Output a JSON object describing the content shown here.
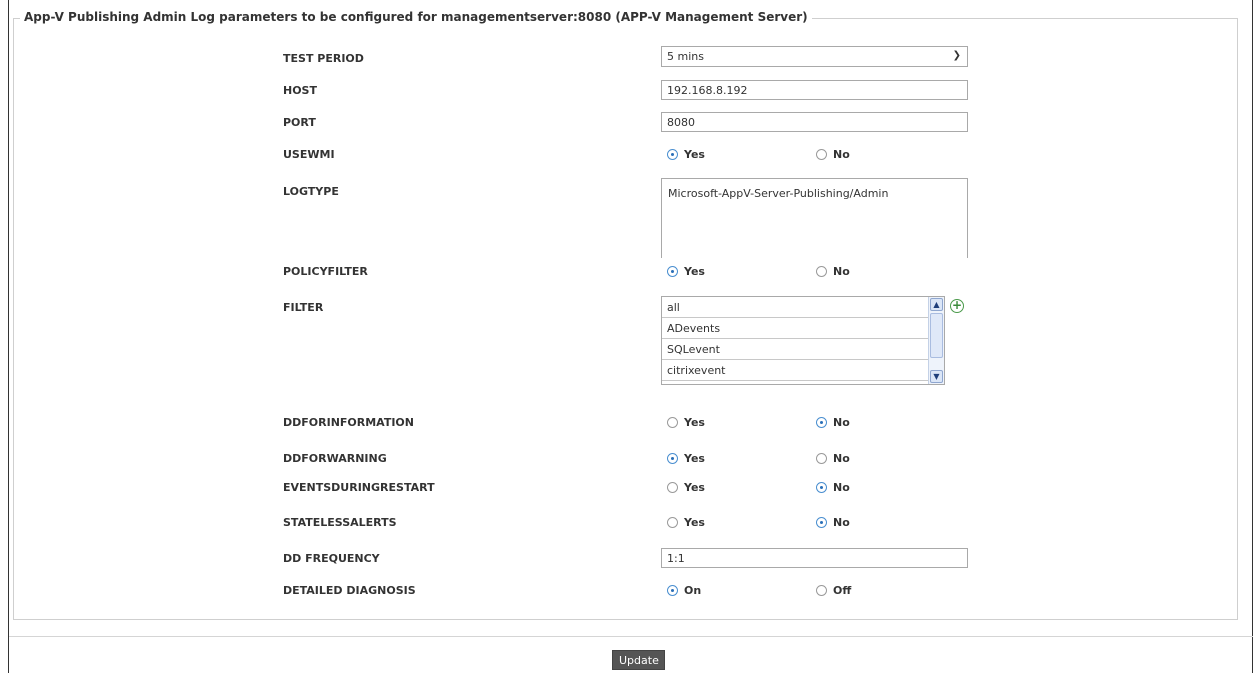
{
  "legend": "App-V Publishing Admin Log parameters to be configured for managementserver:8080 (APP-V Management Server)",
  "fields": {
    "test_period": {
      "label": "TEST PERIOD",
      "value": "5 mins"
    },
    "host": {
      "label": "HOST",
      "value": "192.168.8.192"
    },
    "port": {
      "label": "PORT",
      "value": "8080"
    },
    "usewmi": {
      "label": "USEWMI",
      "yes": "Yes",
      "no": "No",
      "selected": "Yes"
    },
    "logtype": {
      "label": "LOGTYPE",
      "value": "Microsoft-AppV-Server-Publishing/Admin"
    },
    "policyfilter": {
      "label": "POLICYFILTER",
      "yes": "Yes",
      "no": "No",
      "selected": "Yes"
    },
    "filter": {
      "label": "FILTER",
      "options": [
        "all",
        "ADevents",
        "SQLevent",
        "citrixevent"
      ]
    },
    "ddforinformation": {
      "label": "DDFORINFORMATION",
      "yes": "Yes",
      "no": "No",
      "selected": "No"
    },
    "ddforwarning": {
      "label": "DDFORWARNING",
      "yes": "Yes",
      "no": "No",
      "selected": "Yes"
    },
    "eventsduringrestart": {
      "label": "EVENTSDURINGRESTART",
      "yes": "Yes",
      "no": "No",
      "selected": "No"
    },
    "statelessalerts": {
      "label": "STATELESSALERTS",
      "yes": "Yes",
      "no": "No",
      "selected": "No"
    },
    "dd_frequency": {
      "label": "DD FREQUENCY",
      "value": "1:1"
    },
    "detailed_diagnosis": {
      "label": "DETAILED DIAGNOSIS",
      "on": "On",
      "off": "Off",
      "selected": "On"
    }
  },
  "icons": {
    "select_caret": "chevron-down-icon",
    "scroll_up": "arrow-up-icon",
    "scroll_down": "arrow-down-icon",
    "add": "plus-circle-icon"
  },
  "colors": {
    "radio_selected": "#2a6fb8",
    "add_icon": "#3a8a3a",
    "update_button": "#555555"
  },
  "update_label": "Update"
}
